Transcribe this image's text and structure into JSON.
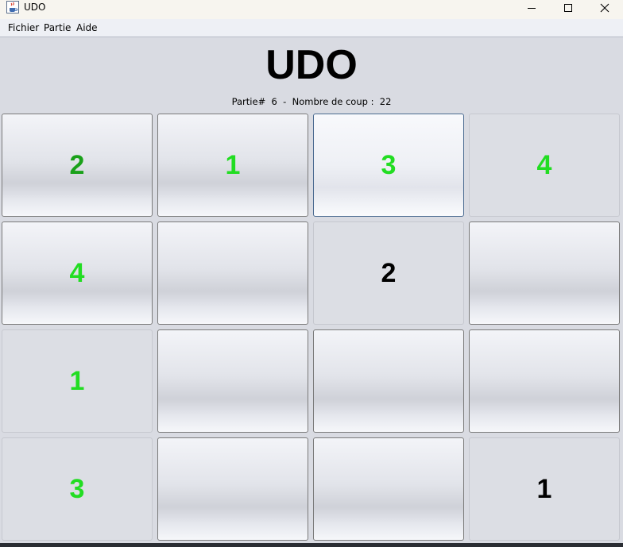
{
  "window": {
    "title": "UDO",
    "app_icon": "java-cup-icon",
    "controls": [
      "minimize-icon",
      "maximize-icon",
      "close-icon"
    ]
  },
  "menu": {
    "items": [
      {
        "label": "Fichier"
      },
      {
        "label": "Partie"
      },
      {
        "label": "Aide"
      }
    ]
  },
  "game": {
    "title": "UDO",
    "status": "Partie#  6  -  Nombre de coup :  22"
  },
  "colors": {
    "green_bright": "#22dd22",
    "green_dark": "#1aa11a",
    "black": "#000000"
  },
  "board": {
    "rows": [
      [
        {
          "value": "2",
          "color": "#1aa11a",
          "style": "raised"
        },
        {
          "value": "1",
          "color": "#22dd22",
          "style": "raised"
        },
        {
          "value": "3",
          "color": "#22dd22",
          "style": "focused"
        },
        {
          "value": "4",
          "color": "#22dd22",
          "style": "flat"
        }
      ],
      [
        {
          "value": "4",
          "color": "#22dd22",
          "style": "raised"
        },
        {
          "value": "",
          "color": "#000000",
          "style": "raised"
        },
        {
          "value": "2",
          "color": "#000000",
          "style": "flat"
        },
        {
          "value": "",
          "color": "#000000",
          "style": "raised"
        }
      ],
      [
        {
          "value": "1",
          "color": "#22dd22",
          "style": "flat"
        },
        {
          "value": "",
          "color": "#000000",
          "style": "raised"
        },
        {
          "value": "",
          "color": "#000000",
          "style": "raised"
        },
        {
          "value": "",
          "color": "#000000",
          "style": "raised"
        }
      ],
      [
        {
          "value": "3",
          "color": "#22dd22",
          "style": "flat"
        },
        {
          "value": "",
          "color": "#000000",
          "style": "raised"
        },
        {
          "value": "",
          "color": "#000000",
          "style": "raised"
        },
        {
          "value": "1",
          "color": "#000000",
          "style": "flat"
        }
      ]
    ]
  }
}
